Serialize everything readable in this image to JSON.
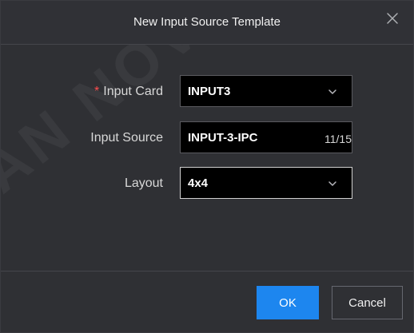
{
  "dialog": {
    "title": "New Input Source Template",
    "close_icon": "close-icon",
    "watermark": "AN NOVAR"
  },
  "form": {
    "input_card": {
      "required_mark": "*",
      "label": "Input Card",
      "value": "INPUT3",
      "icon": "chevron-down-icon"
    },
    "input_source": {
      "label": "Input Source",
      "value": "INPUT-3-IPC",
      "count": "11/15"
    },
    "layout": {
      "label": "Layout",
      "value": "4x4",
      "icon": "chevron-down-icon"
    }
  },
  "footer": {
    "ok_label": "OK",
    "cancel_label": "Cancel"
  },
  "colors": {
    "accent": "#1d86ef",
    "required": "#ff4d4f",
    "dialog_background": "#2f3034",
    "field_background": "#000000"
  }
}
